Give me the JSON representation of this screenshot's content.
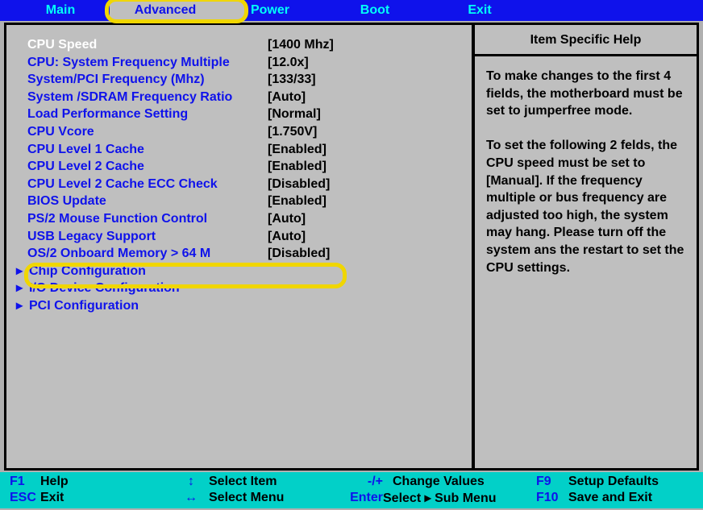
{
  "menubar": {
    "tabs": [
      "Main",
      "Advanced",
      "Power",
      "Boot",
      "Exit"
    ],
    "activeIndex": 1
  },
  "help": {
    "title": "Item Specific Help",
    "body": "To make changes to the first 4 fields, the motherboard must be set to jumperfree mode.\n\nTo set the following 2 felds, the CPU speed must be set to [Manual]. If the frequency multiple or bus frequency are adjusted too high, the system may hang. Please turn off the system ans the restart to set the CPU settings."
  },
  "settings": [
    {
      "label": "CPU Speed",
      "value": "[1400 Mhz]",
      "selected": true
    },
    {
      "label": "CPU: System Frequency Multiple",
      "value": "[12.0x]"
    },
    {
      "label": "System/PCI Frequency (Mhz)",
      "value": "[133/33]"
    },
    {
      "label": "System /SDRAM Frequency Ratio",
      "value": "[Auto]"
    },
    {
      "label": "Load Performance Setting",
      "value": "[Normal]"
    },
    {
      "label": "CPU Vcore",
      "value": "[1.750V]"
    },
    {
      "label": "CPU Level 1 Cache",
      "value": "[Enabled]"
    },
    {
      "label": "CPU Level 2 Cache",
      "value": "[Enabled]"
    },
    {
      "label": "CPU Level 2 Cache ECC Check",
      "value": "[Disabled]"
    },
    {
      "label": "BIOS Update",
      "value": "[Enabled]"
    },
    {
      "label": "PS/2 Mouse Function Control",
      "value": "[Auto]"
    },
    {
      "label": "USB Legacy Support",
      "value": "[Auto]",
      "highlighted": true
    },
    {
      "label": "OS/2 Onboard Memory > 64 M",
      "value": "[Disabled]"
    }
  ],
  "submenus": [
    {
      "label": "Chip Configuration"
    },
    {
      "label": "I/O Device Configuration"
    },
    {
      "label": "PCI Configuration"
    }
  ],
  "footer": {
    "row1": {
      "k1": "F1",
      "l1": "Help",
      "k2": "↕",
      "l2": "Select Item",
      "k3": "-/+",
      "l3": "Change Values",
      "k4": "F9",
      "l4": "Setup Defaults"
    },
    "row2": {
      "k1": "ESC",
      "l1": "Exit",
      "k2": "↔",
      "l2": "Select Menu",
      "k3": "Enter",
      "l3": "Select ▸ Sub Menu",
      "k4": "F10",
      "l4": "Save and Exit"
    }
  }
}
